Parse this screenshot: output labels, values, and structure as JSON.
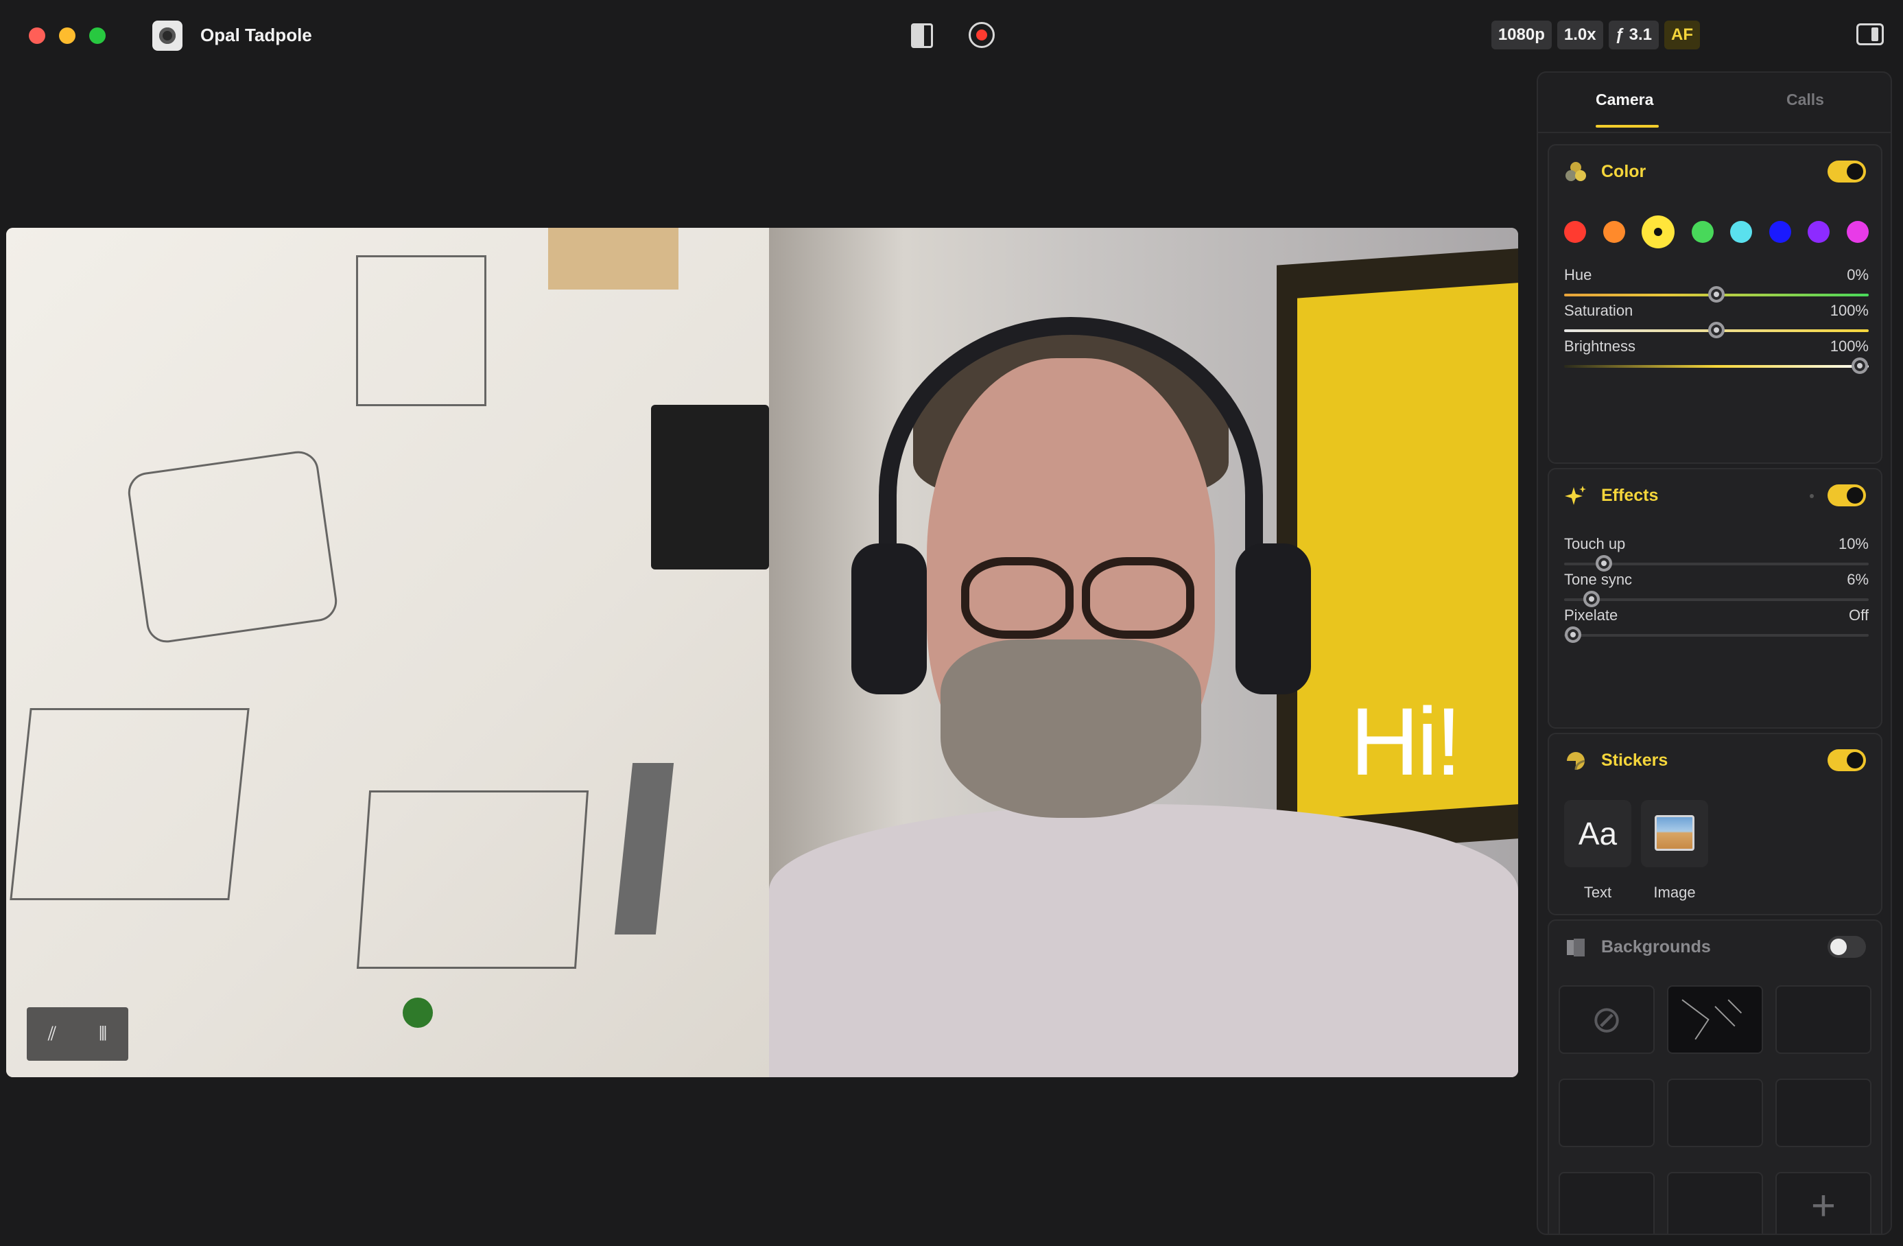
{
  "window": {
    "title": "Opal Tadpole",
    "chips": [
      "1080p",
      "1.0x",
      "ƒ 3.1",
      "AF"
    ]
  },
  "preview": {
    "sticker_text": "Hi!"
  },
  "panel": {
    "tabs": [
      {
        "label": "Camera",
        "active": true
      },
      {
        "label": "Calls",
        "active": false
      }
    ],
    "color": {
      "title": "Color",
      "enabled": true,
      "swatches": [
        "#ff3b30",
        "#ff8a2b",
        "#ffe53b",
        "#48d85a",
        "#5ae0ee",
        "#1a1aff",
        "#8d2bff",
        "#e83be8"
      ],
      "selected_swatch": 2,
      "sliders": [
        {
          "label": "Hue",
          "value": "0%",
          "level": 0.5
        },
        {
          "label": "Saturation",
          "value": "100%",
          "level": 0.5
        },
        {
          "label": "Brightness",
          "value": "100%",
          "level": 0.97
        }
      ]
    },
    "effects": {
      "title": "Effects",
      "enabled": true,
      "sliders": [
        {
          "label": "Touch up",
          "value": "10%",
          "level": 0.13
        },
        {
          "label": "Tone sync",
          "value": "6%",
          "level": 0.09
        },
        {
          "label": "Pixelate",
          "value": "Off",
          "level": 0.03
        }
      ]
    },
    "stickers": {
      "title": "Stickers",
      "enabled": true,
      "items": [
        {
          "label": "Text",
          "glyph": "Aa"
        },
        {
          "label": "Image"
        }
      ]
    },
    "backgrounds": {
      "title": "Backgrounds",
      "enabled": false
    }
  },
  "colors": {
    "accent": "#f5d63b",
    "background": "#1b1b1c",
    "panel": "#1f1f21"
  }
}
